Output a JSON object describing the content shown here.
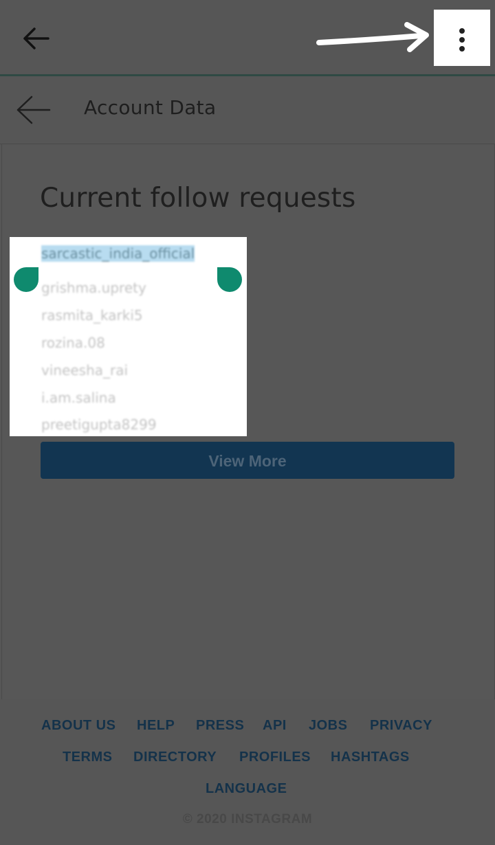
{
  "header": {
    "back_icon": "arrow-left-icon",
    "menu_icon": "more-vertical-icon"
  },
  "subheader": {
    "back_icon": "arrow-left-icon",
    "title": "Account Data"
  },
  "section": {
    "title": "Current follow requests"
  },
  "requests": [
    "sarcastic_india_official",
    "grishma.uprety",
    "rasmita_karki5",
    "rozina.08",
    "vineesha_rai",
    "i.am.salina",
    "preetigupta8299"
  ],
  "view_more_label": "View More",
  "footer": {
    "links": [
      "ABOUT US",
      "HELP",
      "PRESS",
      "API",
      "JOBS",
      "PRIVACY",
      "TERMS",
      "DIRECTORY",
      "PROFILES",
      "HASHTAGS",
      "LANGUAGE"
    ],
    "copyright": "© 2020 INSTAGRAM"
  },
  "colors": {
    "accent_button": "#123551",
    "selection_handle": "#0f8a6e",
    "selection_highlight": "#b8dcf0"
  }
}
